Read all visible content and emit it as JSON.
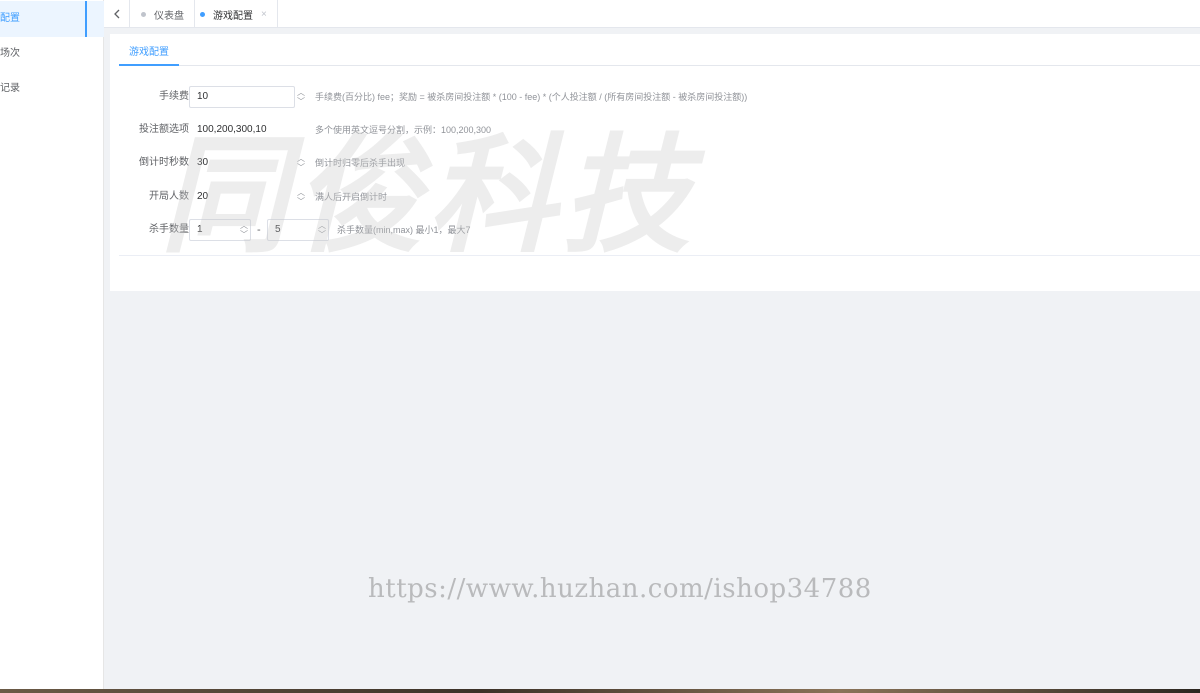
{
  "sidebar": {
    "items": [
      {
        "label": "戏配置",
        "active": true
      },
      {
        "label": "戏场次",
        "active": false
      },
      {
        "label": "戏记录",
        "active": false
      }
    ]
  },
  "tagsbar": {
    "back_icon": "chevron-left-icon",
    "tags": [
      {
        "label": "仪表盘",
        "active": false
      },
      {
        "label": "游戏配置",
        "active": true,
        "close": "×"
      }
    ]
  },
  "tabs": {
    "active_label": "游戏配置"
  },
  "form": {
    "fee": {
      "label": "手续费",
      "value": "10",
      "hint": "手续费(百分比) fee；奖励 = 被杀房间投注额 * (100 - fee) * (个人投注额 / (所有房间投注额 - 被杀房间投注额))"
    },
    "bet_options": {
      "label": "投注额选项",
      "value": "100,200,300,10",
      "hint": "多个使用英文逗号分割，示例：100,200,300"
    },
    "countdown": {
      "label": "倒计时秒数",
      "value": "30",
      "hint": "倒计时归零后杀手出现"
    },
    "players": {
      "label": "开局人数",
      "value": "20",
      "hint": "满人后开启倒计时"
    },
    "killers": {
      "label": "杀手数量",
      "min": "1",
      "separator": "-",
      "max": "5",
      "hint": "杀手数量(min,max) 最小1，最大7"
    }
  },
  "watermarks": {
    "logo_text": "同俊科技",
    "url": "https://www.huzhan.com/ishop34788"
  },
  "colors": {
    "accent": "#409eff",
    "background": "#f0f2f5"
  }
}
